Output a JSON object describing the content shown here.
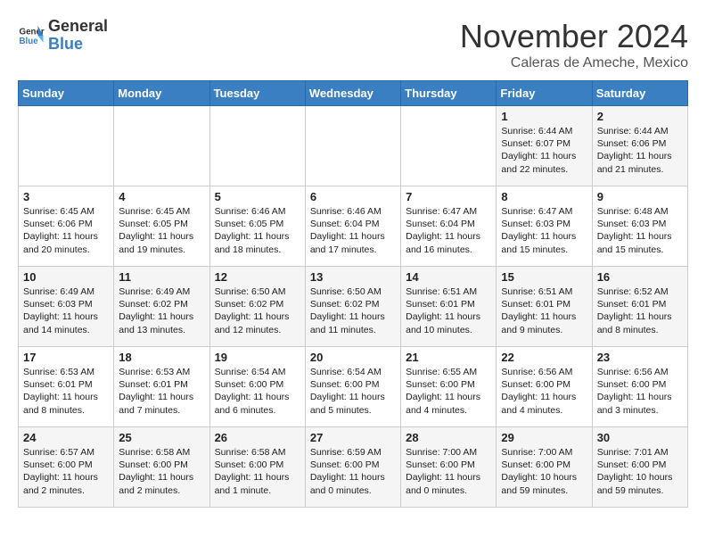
{
  "header": {
    "logo_line1": "General",
    "logo_line2": "Blue",
    "month": "November 2024",
    "location": "Caleras de Ameche, Mexico"
  },
  "weekdays": [
    "Sunday",
    "Monday",
    "Tuesday",
    "Wednesday",
    "Thursday",
    "Friday",
    "Saturday"
  ],
  "weeks": [
    [
      {
        "day": "",
        "info": ""
      },
      {
        "day": "",
        "info": ""
      },
      {
        "day": "",
        "info": ""
      },
      {
        "day": "",
        "info": ""
      },
      {
        "day": "",
        "info": ""
      },
      {
        "day": "1",
        "info": "Sunrise: 6:44 AM\nSunset: 6:07 PM\nDaylight: 11 hours\nand 22 minutes."
      },
      {
        "day": "2",
        "info": "Sunrise: 6:44 AM\nSunset: 6:06 PM\nDaylight: 11 hours\nand 21 minutes."
      }
    ],
    [
      {
        "day": "3",
        "info": "Sunrise: 6:45 AM\nSunset: 6:06 PM\nDaylight: 11 hours\nand 20 minutes."
      },
      {
        "day": "4",
        "info": "Sunrise: 6:45 AM\nSunset: 6:05 PM\nDaylight: 11 hours\nand 19 minutes."
      },
      {
        "day": "5",
        "info": "Sunrise: 6:46 AM\nSunset: 6:05 PM\nDaylight: 11 hours\nand 18 minutes."
      },
      {
        "day": "6",
        "info": "Sunrise: 6:46 AM\nSunset: 6:04 PM\nDaylight: 11 hours\nand 17 minutes."
      },
      {
        "day": "7",
        "info": "Sunrise: 6:47 AM\nSunset: 6:04 PM\nDaylight: 11 hours\nand 16 minutes."
      },
      {
        "day": "8",
        "info": "Sunrise: 6:47 AM\nSunset: 6:03 PM\nDaylight: 11 hours\nand 15 minutes."
      },
      {
        "day": "9",
        "info": "Sunrise: 6:48 AM\nSunset: 6:03 PM\nDaylight: 11 hours\nand 15 minutes."
      }
    ],
    [
      {
        "day": "10",
        "info": "Sunrise: 6:49 AM\nSunset: 6:03 PM\nDaylight: 11 hours\nand 14 minutes."
      },
      {
        "day": "11",
        "info": "Sunrise: 6:49 AM\nSunset: 6:02 PM\nDaylight: 11 hours\nand 13 minutes."
      },
      {
        "day": "12",
        "info": "Sunrise: 6:50 AM\nSunset: 6:02 PM\nDaylight: 11 hours\nand 12 minutes."
      },
      {
        "day": "13",
        "info": "Sunrise: 6:50 AM\nSunset: 6:02 PM\nDaylight: 11 hours\nand 11 minutes."
      },
      {
        "day": "14",
        "info": "Sunrise: 6:51 AM\nSunset: 6:01 PM\nDaylight: 11 hours\nand 10 minutes."
      },
      {
        "day": "15",
        "info": "Sunrise: 6:51 AM\nSunset: 6:01 PM\nDaylight: 11 hours\nand 9 minutes."
      },
      {
        "day": "16",
        "info": "Sunrise: 6:52 AM\nSunset: 6:01 PM\nDaylight: 11 hours\nand 8 minutes."
      }
    ],
    [
      {
        "day": "17",
        "info": "Sunrise: 6:53 AM\nSunset: 6:01 PM\nDaylight: 11 hours\nand 8 minutes."
      },
      {
        "day": "18",
        "info": "Sunrise: 6:53 AM\nSunset: 6:01 PM\nDaylight: 11 hours\nand 7 minutes."
      },
      {
        "day": "19",
        "info": "Sunrise: 6:54 AM\nSunset: 6:00 PM\nDaylight: 11 hours\nand 6 minutes."
      },
      {
        "day": "20",
        "info": "Sunrise: 6:54 AM\nSunset: 6:00 PM\nDaylight: 11 hours\nand 5 minutes."
      },
      {
        "day": "21",
        "info": "Sunrise: 6:55 AM\nSunset: 6:00 PM\nDaylight: 11 hours\nand 4 minutes."
      },
      {
        "day": "22",
        "info": "Sunrise: 6:56 AM\nSunset: 6:00 PM\nDaylight: 11 hours\nand 4 minutes."
      },
      {
        "day": "23",
        "info": "Sunrise: 6:56 AM\nSunset: 6:00 PM\nDaylight: 11 hours\nand 3 minutes."
      }
    ],
    [
      {
        "day": "24",
        "info": "Sunrise: 6:57 AM\nSunset: 6:00 PM\nDaylight: 11 hours\nand 2 minutes."
      },
      {
        "day": "25",
        "info": "Sunrise: 6:58 AM\nSunset: 6:00 PM\nDaylight: 11 hours\nand 2 minutes."
      },
      {
        "day": "26",
        "info": "Sunrise: 6:58 AM\nSunset: 6:00 PM\nDaylight: 11 hours\nand 1 minute."
      },
      {
        "day": "27",
        "info": "Sunrise: 6:59 AM\nSunset: 6:00 PM\nDaylight: 11 hours\nand 0 minutes."
      },
      {
        "day": "28",
        "info": "Sunrise: 7:00 AM\nSunset: 6:00 PM\nDaylight: 11 hours\nand 0 minutes."
      },
      {
        "day": "29",
        "info": "Sunrise: 7:00 AM\nSunset: 6:00 PM\nDaylight: 10 hours\nand 59 minutes."
      },
      {
        "day": "30",
        "info": "Sunrise: 7:01 AM\nSunset: 6:00 PM\nDaylight: 10 hours\nand 59 minutes."
      }
    ]
  ]
}
